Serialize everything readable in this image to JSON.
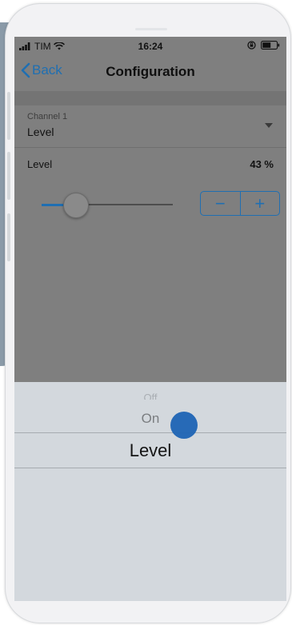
{
  "status_bar": {
    "carrier": "TIM",
    "time": "16:24"
  },
  "nav": {
    "back_label": "Back",
    "title": "Configuration"
  },
  "channel_field": {
    "label": "Channel 1",
    "value": "Level"
  },
  "level_row": {
    "label": "Level",
    "value_text": "43 %",
    "slider_percent": 43
  },
  "stepper": {
    "minus": "−",
    "plus": "+"
  },
  "picker": {
    "items_faded": "Off",
    "item_above": "On",
    "item_selected": "Level"
  },
  "colors": {
    "accent": "#1f6fb2",
    "touch_indicator": "#1e64b4",
    "overlay_dim": "#7f7f7f",
    "picker_bg": "#d3d8dd"
  },
  "icons": {
    "signal": "signal-bars-icon",
    "wifi": "wifi-icon",
    "orientation_lock": "orientation-lock-icon",
    "battery": "battery-icon",
    "back_chevron": "chevron-left-icon",
    "dropdown_caret": "caret-down-icon"
  }
}
